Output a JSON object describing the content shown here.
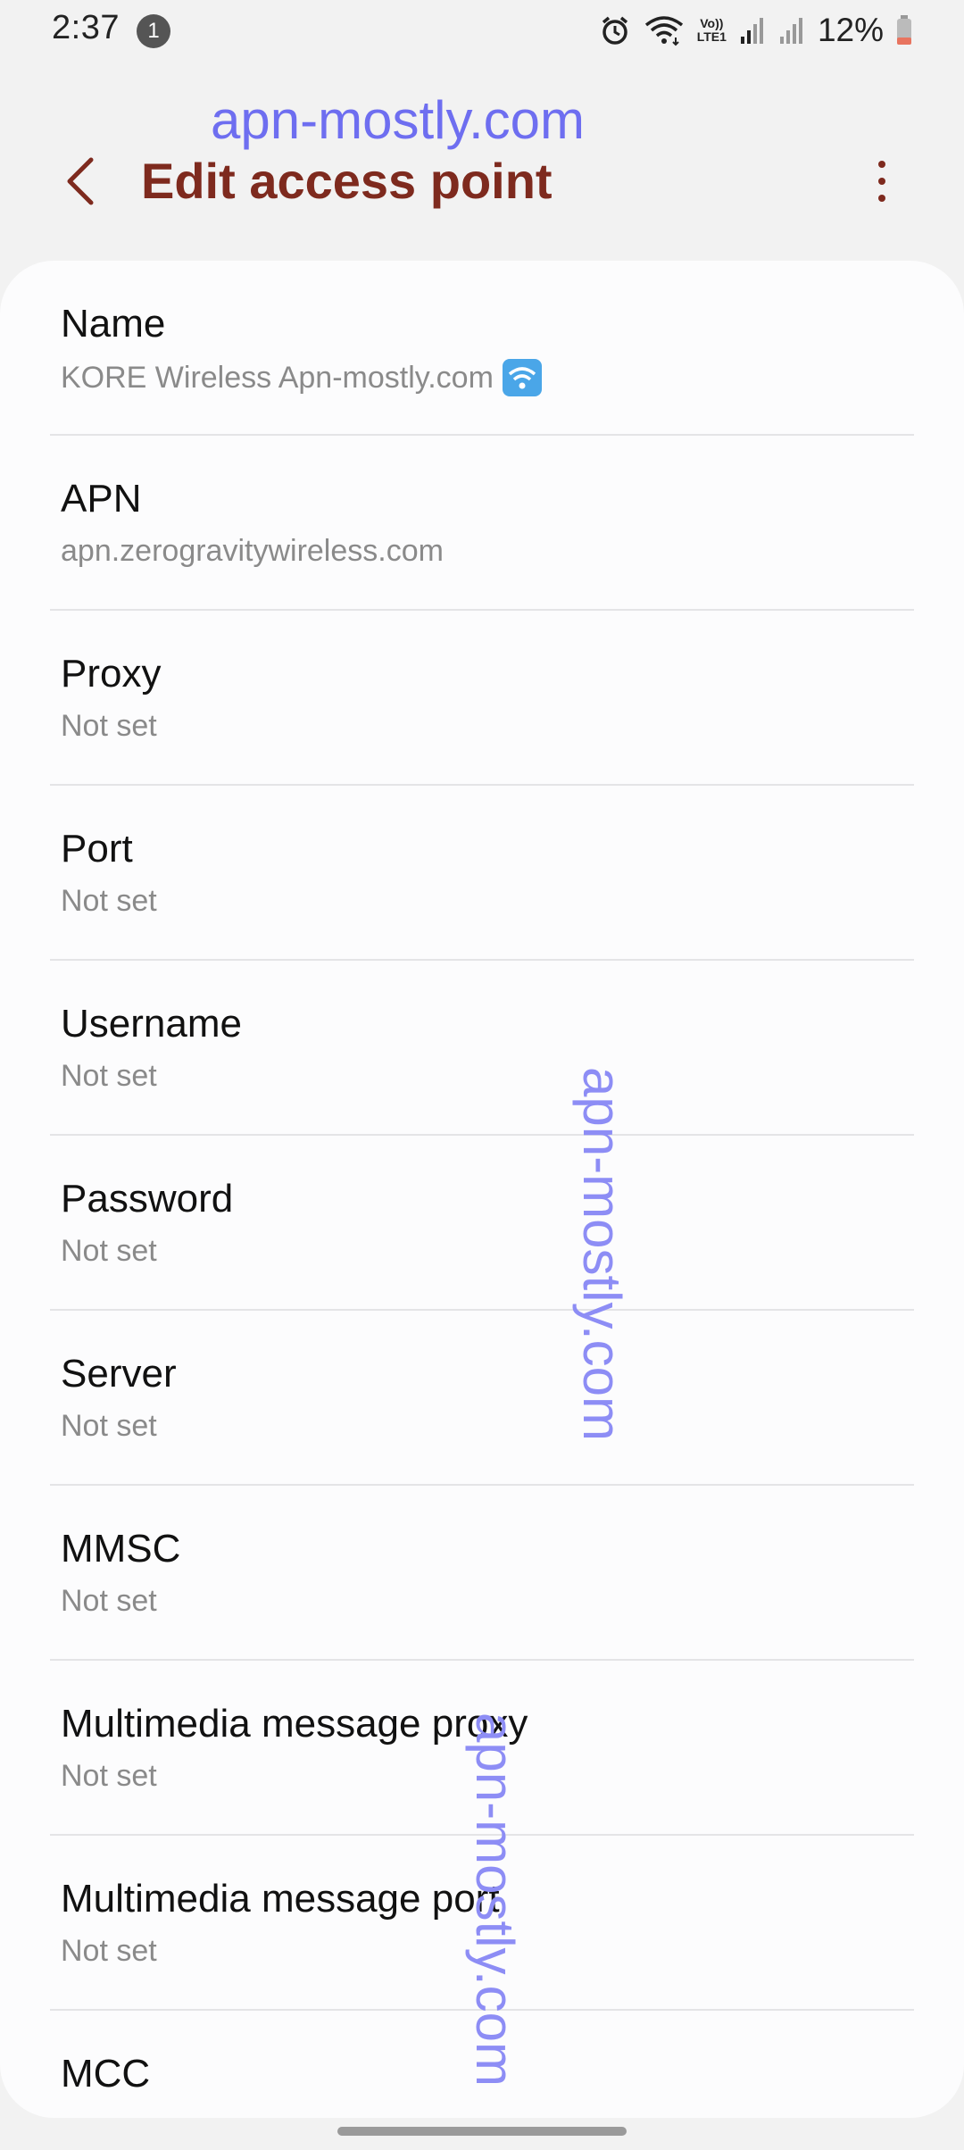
{
  "status_bar": {
    "time": "2:37",
    "notification_count": "1",
    "battery": "12%",
    "network_label_top": "Vo))",
    "network_label_bottom": "LTE1"
  },
  "header": {
    "watermark": "apn-mostly.com",
    "title": "Edit access point"
  },
  "items": [
    {
      "label": "Name",
      "value": "KORE Wireless Apn-mostly.com"
    },
    {
      "label": "APN",
      "value": "apn.zerogravitywireless.com"
    },
    {
      "label": "Proxy",
      "value": "Not set"
    },
    {
      "label": "Port",
      "value": "Not set"
    },
    {
      "label": "Username",
      "value": "Not set"
    },
    {
      "label": "Password",
      "value": "Not set"
    },
    {
      "label": "Server",
      "value": "Not set"
    },
    {
      "label": "MMSC",
      "value": "Not set"
    },
    {
      "label": "Multimedia message proxy",
      "value": "Not set"
    },
    {
      "label": "Multimedia message port",
      "value": "Not set"
    },
    {
      "label": "MCC",
      "value": ""
    }
  ],
  "watermarks": {
    "vertical_1": "apn-mostly.com",
    "vertical_2": "apn-mostly.com"
  },
  "colors": {
    "title": "#7e2a1e",
    "watermark": "#6e6ef0",
    "background": "#f2f2f2",
    "card": "#fcfcfd"
  }
}
